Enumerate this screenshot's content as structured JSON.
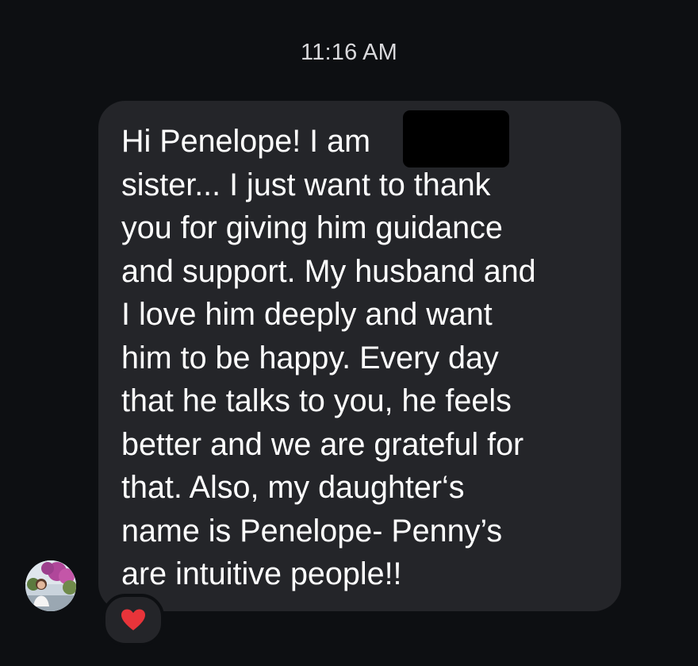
{
  "thread": {
    "timestamp": "11:16 AM"
  },
  "message": {
    "text": "Hi Penelope! I am\nsister... I just want to thank\nyou for giving him guidance\nand support. My husband and\nI love him deeply and want\nhim to be happy. Every day\nthat he talks to you, he feels\nbetter and we are grateful for\nthat. Also, my daughter‘s\nname is Penelope- Penny’s\nare intuitive people!!",
    "redacted": true
  },
  "sender": {
    "avatar_icon": "profile-photo"
  },
  "reaction": {
    "icon": "red-heart-icon",
    "color": "#e8343a"
  },
  "colors": {
    "background": "#0d0f12",
    "bubble": "#242529",
    "text": "#ffffff",
    "timestamp": "#d9d9dc"
  }
}
